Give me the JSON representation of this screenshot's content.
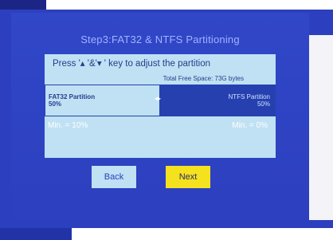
{
  "title": "Step3:FAT32 & NTFS Partitioning",
  "instruction": "Press '▴ '&'▾ ' key to adjust the partition",
  "free_space": "Total Free Space: 73G bytes",
  "partition": {
    "fat32": {
      "name": "FAT32 Partition",
      "percent": "50%"
    },
    "ntfs": {
      "name": "NTFS Partition",
      "percent": "50%"
    },
    "fat32_fraction": 0.5,
    "handle": "◂▸"
  },
  "minimums": {
    "fat32": "Min. = 10%",
    "ntfs": "Min. = 0%"
  },
  "buttons": {
    "back": "Back",
    "next": "Next"
  },
  "colors": {
    "background": "#2c3fbf",
    "panel": "#bfe1f3",
    "ntfs_segment": "#2640b0",
    "next_button": "#f5e21f"
  }
}
